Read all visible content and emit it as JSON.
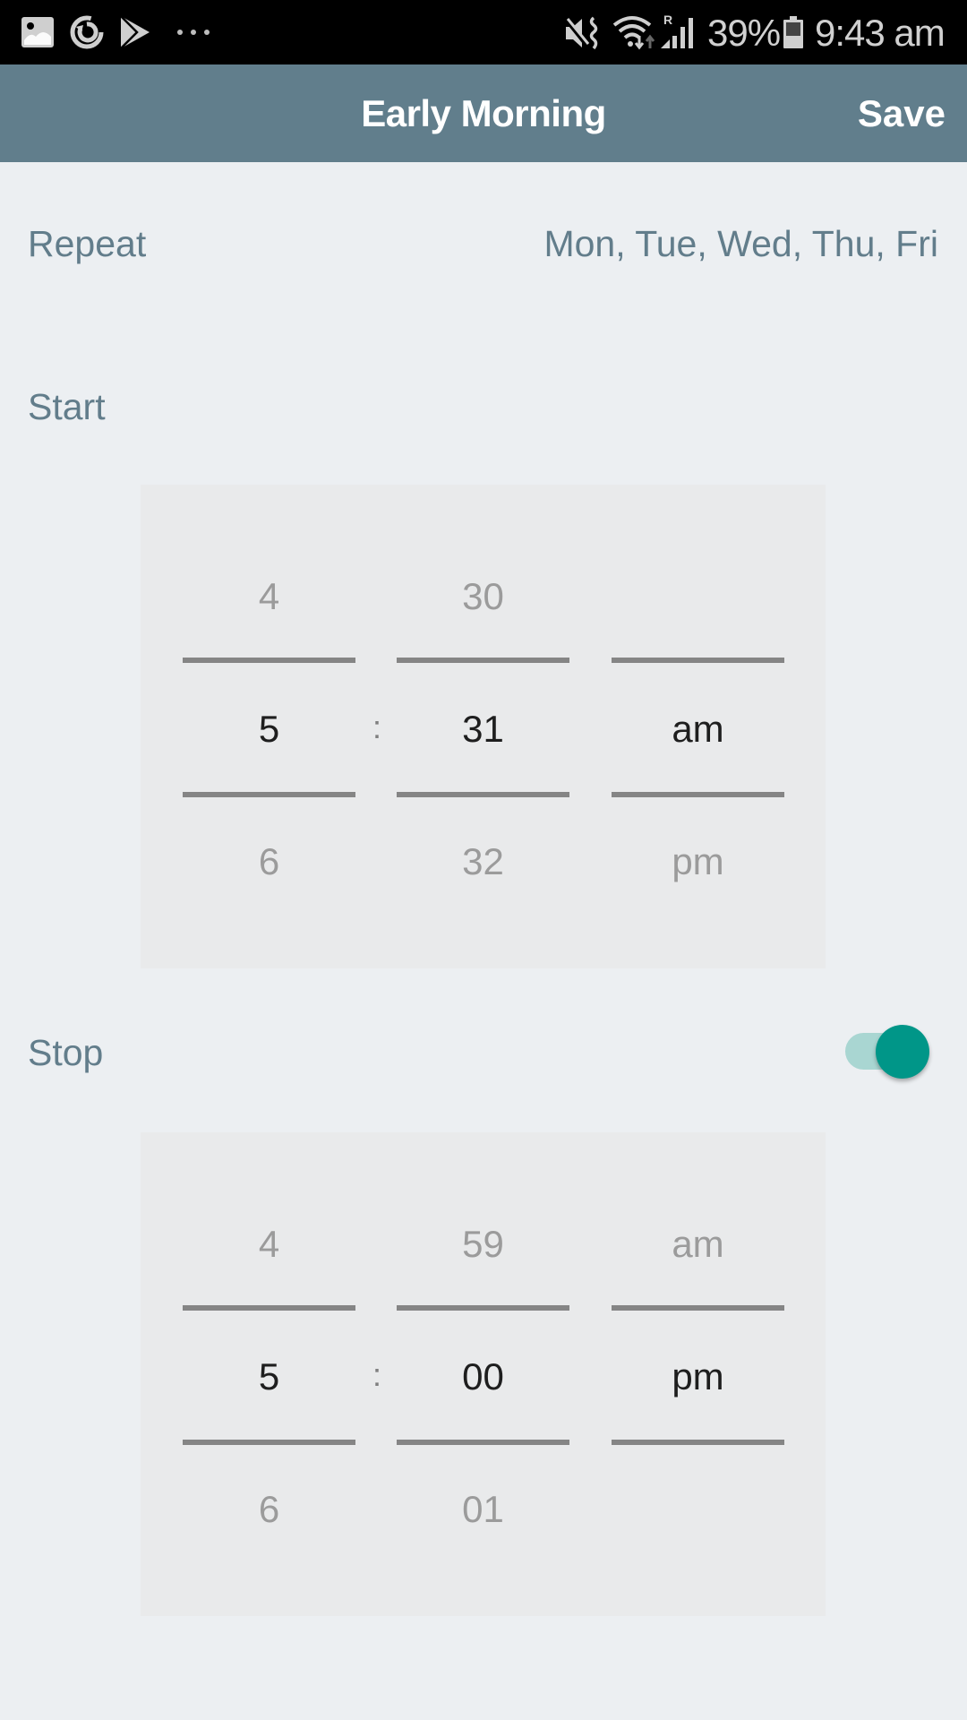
{
  "status_bar": {
    "left_icons": [
      "gallery-icon",
      "sync-icon",
      "play-store-icon",
      "more-dots-icon"
    ],
    "right_icons": [
      "mute-vibrate-icon",
      "wifi-icon",
      "roaming-signal-icon",
      "battery-icon"
    ],
    "battery_percent": "39%",
    "time": "9:43 am",
    "roaming_label": "R"
  },
  "app_bar": {
    "title": "Early Morning",
    "save_label": "Save",
    "color": "#617e8c"
  },
  "repeat": {
    "label": "Repeat",
    "value": "Mon, Tue, Wed, Thu, Fri"
  },
  "start": {
    "label": "Start",
    "picker": {
      "separator": ":",
      "hour": {
        "prev": "4",
        "selected": "5",
        "next": "6"
      },
      "minute": {
        "prev": "30",
        "selected": "31",
        "next": "32"
      },
      "period": {
        "prev": "",
        "selected": "am",
        "next": "pm"
      }
    }
  },
  "stop": {
    "label": "Stop",
    "enabled": true,
    "toggle_color": "#009688",
    "picker": {
      "separator": ":",
      "hour": {
        "prev": "4",
        "selected": "5",
        "next": "6"
      },
      "minute": {
        "prev": "59",
        "selected": "00",
        "next": "01"
      },
      "period": {
        "prev": "am",
        "selected": "pm",
        "next": ""
      }
    }
  }
}
